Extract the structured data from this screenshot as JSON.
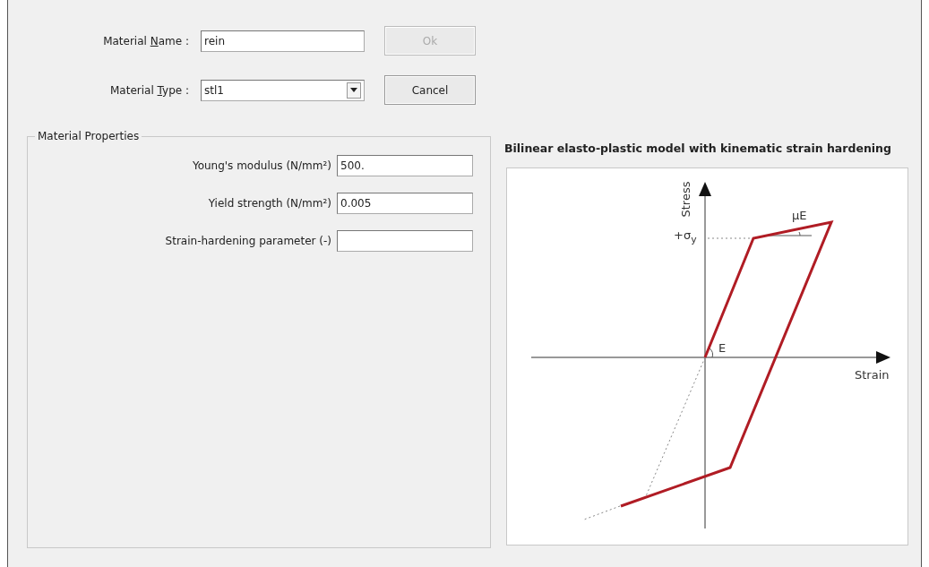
{
  "header_fields": [
    {
      "kind": "text",
      "label_before": "Material ",
      "access_key": "N",
      "label_after": "ame :",
      "value": "rein"
    },
    {
      "kind": "dropdown",
      "label_before": "Material ",
      "access_key": "T",
      "label_after": "ype :",
      "value": "stl1"
    }
  ],
  "buttons": [
    {
      "label": "Ok",
      "disabled": true
    },
    {
      "label": "Cancel",
      "disabled": false
    }
  ],
  "material_properties": {
    "title": "Material Properties",
    "fields": [
      {
        "label": "Young's modulus (N/mm²)",
        "value": "500."
      },
      {
        "label": "Yield strength (N/mm²)",
        "value": "0.005"
      },
      {
        "label": "Strain-hardening parameter (-)"
      }
    ]
  },
  "diagram": {
    "title": "Bilinear elasto-plastic model with kinematic strain hardening",
    "y_axis_label": "Stress",
    "x_axis_label": "Strain",
    "yield_label": "+σ$_{y}$",
    "hardening_label": "μE",
    "modulus_label": "E"
  }
}
